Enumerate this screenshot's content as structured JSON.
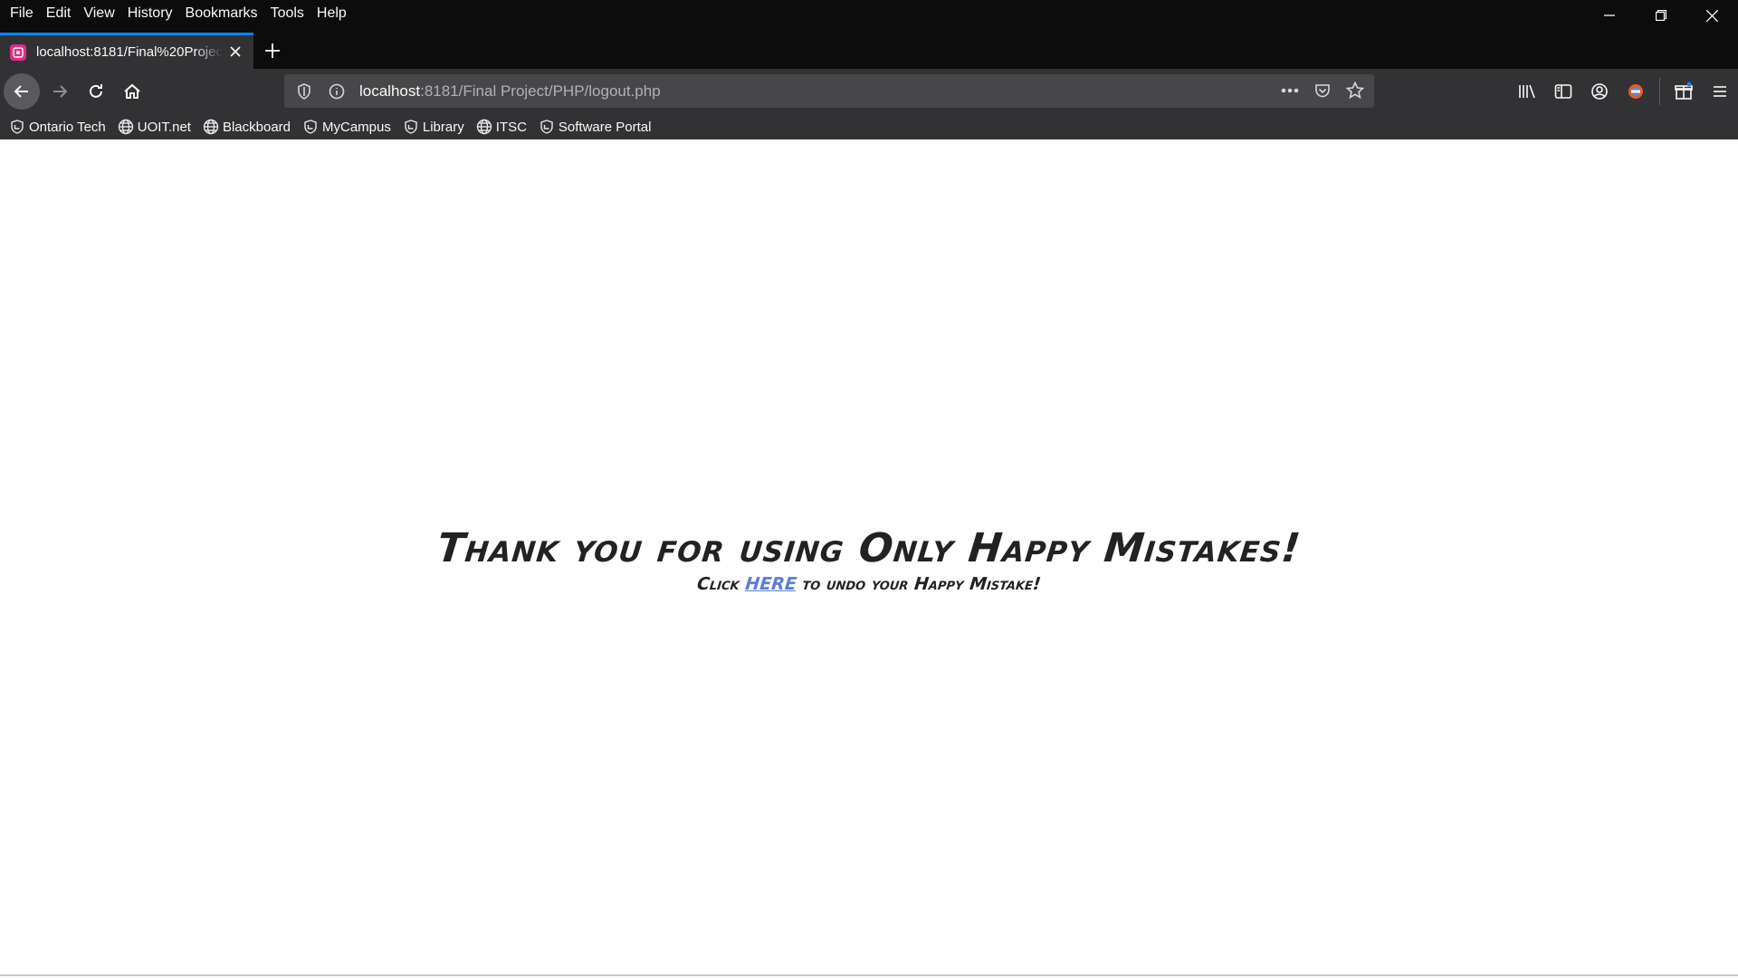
{
  "menu": {
    "items": [
      "File",
      "Edit",
      "View",
      "History",
      "Bookmarks",
      "Tools",
      "Help"
    ]
  },
  "tab": {
    "title": "localhost:8181/Final%20Project/PHP/logout.php",
    "favicon": "app-favicon-icon"
  },
  "urlbar": {
    "host": "localhost",
    "rest": ":8181/Final Project/PHP/logout.php"
  },
  "bookmarks": [
    {
      "label": "Ontario Tech",
      "icon": "shield-bookmark-icon"
    },
    {
      "label": "UOIT.net",
      "icon": "globe-icon"
    },
    {
      "label": "Blackboard",
      "icon": "globe-icon"
    },
    {
      "label": "MyCampus",
      "icon": "shield-bookmark-icon"
    },
    {
      "label": "Library",
      "icon": "shield-bookmark-icon"
    },
    {
      "label": "ITSC",
      "icon": "globe-icon"
    },
    {
      "label": "Software Portal",
      "icon": "shield-bookmark-icon"
    }
  ],
  "page": {
    "heading": "Thank you for using Only Happy Mistakes!",
    "undo_prefix": "Click ",
    "undo_link": "HERE",
    "undo_suffix": " to undo your Happy Mistake!"
  },
  "colors": {
    "chrome_dark": "#0c0c0d",
    "toolbar": "#323234",
    "accent": "#0a84ff",
    "link": "#5a7ed6",
    "favicon": "#e22d85"
  }
}
